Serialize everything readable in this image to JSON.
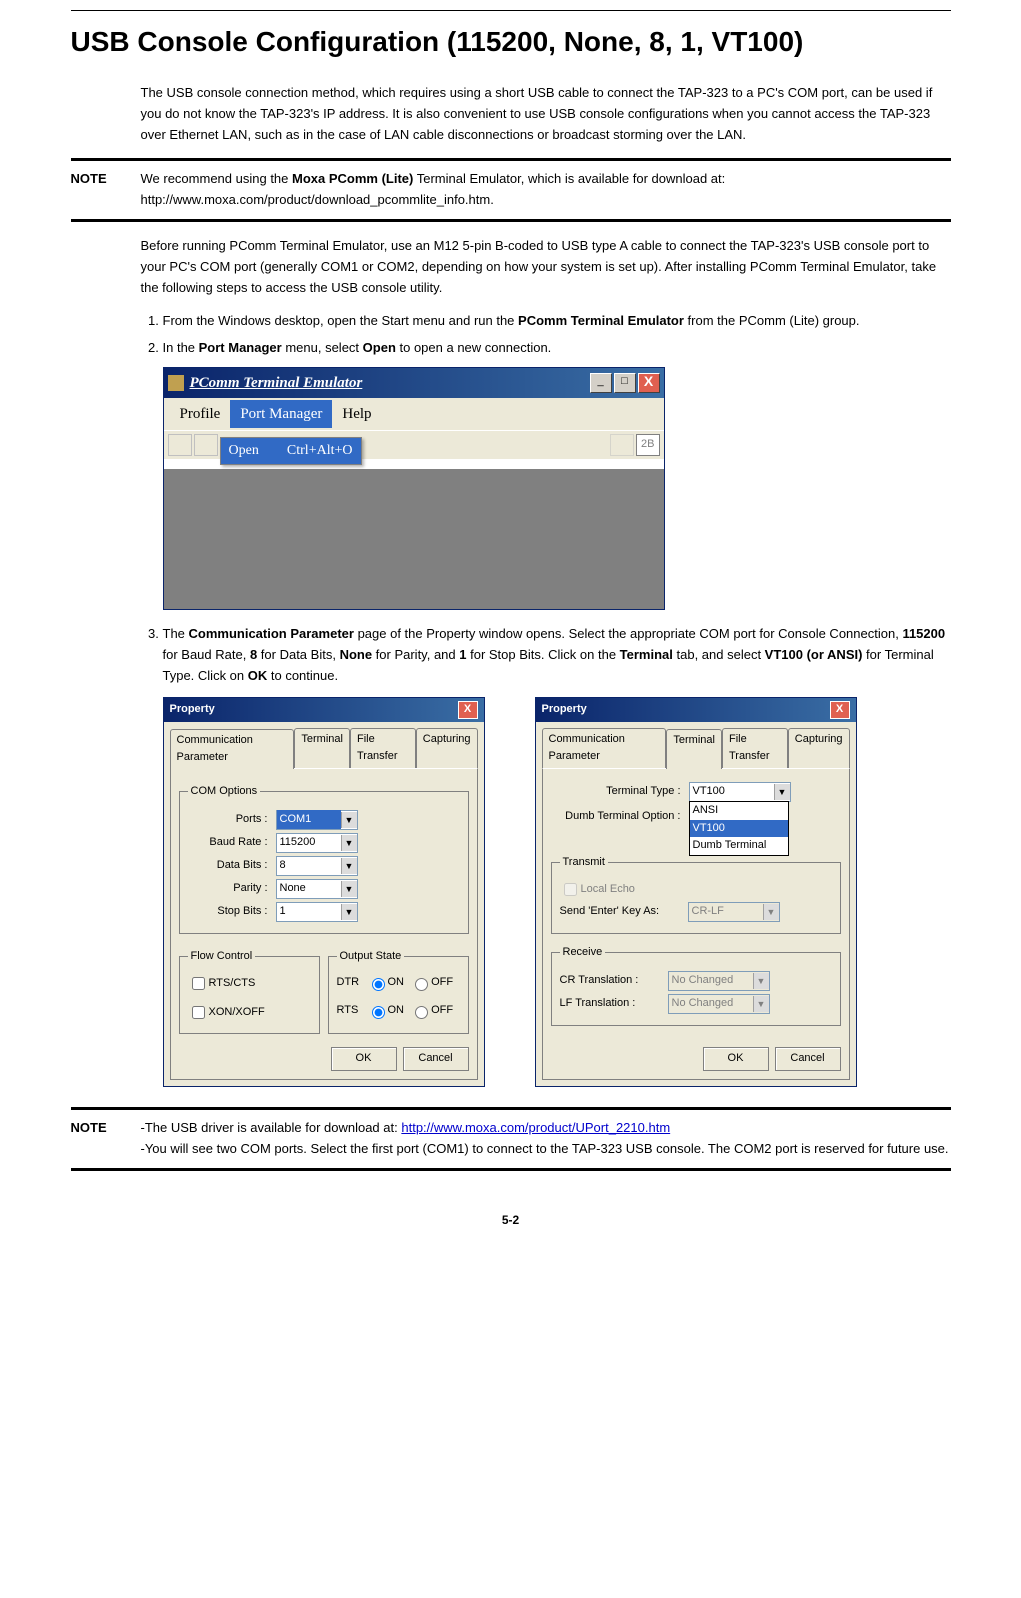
{
  "page": {
    "title": "USB Console Configuration (115200, None, 8, 1, VT100)",
    "intro": "The USB console connection method, which requires using a short USB cable to connect the TAP-323 to a PC's COM port, can be used if you do not know the TAP-323's IP address. It is also convenient to use USB console configurations when you cannot access the TAP-323 over Ethernet LAN, such as in the case of LAN cable disconnections or broadcast storming over the LAN.",
    "page_number": "5-2"
  },
  "note1": {
    "label": "NOTE",
    "text_before_bold": "We recommend using the ",
    "bold": "Moxa PComm (Lite)",
    "text_after_bold": " Terminal Emulator, which is available for download at: http://www.moxa.com/product/download_pcommlite_info.htm."
  },
  "para2": "Before running PComm Terminal Emulator, use an M12 5-pin B-coded to USB type A cable to connect the TAP-323's USB console port to your PC's COM port (generally COM1 or COM2, depending on how your system is set up). After installing PComm Terminal Emulator, take the following steps to access the USB console utility.",
  "steps": {
    "s1_a": "From the Windows desktop, open the Start menu and run the ",
    "s1_bold": "PComm Terminal Emulator",
    "s1_b": " from the PComm (Lite) group.",
    "s2_a": "In the ",
    "s2_bold1": "Port Manager",
    "s2_b": " menu, select ",
    "s2_bold2": "Open",
    "s2_c": " to open a new connection.",
    "s3_a": "The ",
    "s3_bold1": "Communication Parameter",
    "s3_b": " page of the Property window opens. Select the appropriate COM port for Console Connection, ",
    "s3_bold2": "115200",
    "s3_c": " for Baud Rate, ",
    "s3_bold3": "8",
    "s3_d": " for Data Bits, ",
    "s3_bold4": "None",
    "s3_e": " for Parity, and ",
    "s3_bold5": "1",
    "s3_f": " for Stop Bits. Click on the ",
    "s3_bold6": "Terminal",
    "s3_g": " tab, and select ",
    "s3_bold7": "VT100 (or ANSI)",
    "s3_h": " for Terminal Type. Click on ",
    "s3_bold8": "OK",
    "s3_i": " to continue."
  },
  "ss1": {
    "title": "PComm Terminal Emulator",
    "menu": {
      "profile": "Profile",
      "port_manager": "Port Manager",
      "help": "Help"
    },
    "dropdown": {
      "open": "Open",
      "shortcut": "Ctrl+Alt+O"
    },
    "toolbar_num": "2B",
    "winbtn_min": "_",
    "winbtn_max": "□",
    "winbtn_close": "X"
  },
  "dlg1": {
    "title": "Property",
    "tabs": {
      "comm": "Communication Parameter",
      "term": "Terminal",
      "ft": "File Transfer",
      "cap": "Capturing"
    },
    "com_options_legend": "COM Options",
    "labels": {
      "ports": "Ports :",
      "baud": "Baud Rate :",
      "data": "Data Bits :",
      "parity": "Parity :",
      "stop": "Stop Bits :"
    },
    "values": {
      "ports": "COM1",
      "baud": "115200",
      "data": "8",
      "parity": "None",
      "stop": "1"
    },
    "flow_legend": "Flow Control",
    "flow": {
      "rtscts": "RTS/CTS",
      "xonxoff": "XON/XOFF"
    },
    "output_legend": "Output State",
    "output": {
      "dtr": "DTR",
      "rts": "RTS",
      "on": "ON",
      "off": "OFF"
    },
    "ok": "OK",
    "cancel": "Cancel"
  },
  "dlg2": {
    "title": "Property",
    "labels": {
      "termtype": "Terminal Type :",
      "dumb": "Dumb Terminal Option :",
      "localecho": "Local Echo",
      "sendenter": "Send 'Enter' Key As:",
      "cr": "CR Translation :",
      "lf": "LF Translation :"
    },
    "values": {
      "termtype": "VT100",
      "sendenter": "CR-LF",
      "cr": "No Changed",
      "lf": "No Changed"
    },
    "options": {
      "ansi": "ANSI",
      "vt100": "VT100",
      "dumb": "Dumb Terminal"
    },
    "transmit_legend": "Transmit",
    "receive_legend": "Receive",
    "ok": "OK",
    "cancel": "Cancel"
  },
  "note2": {
    "label": "NOTE",
    "line1_a": "-The USB driver is available for download at: ",
    "line1_link": "http://www.moxa.com/product/UPort_2210.htm",
    "line2": "-You will see two COM ports. Select the first port (COM1) to connect to the TAP-323 USB console. The COM2 port is reserved for future use."
  }
}
